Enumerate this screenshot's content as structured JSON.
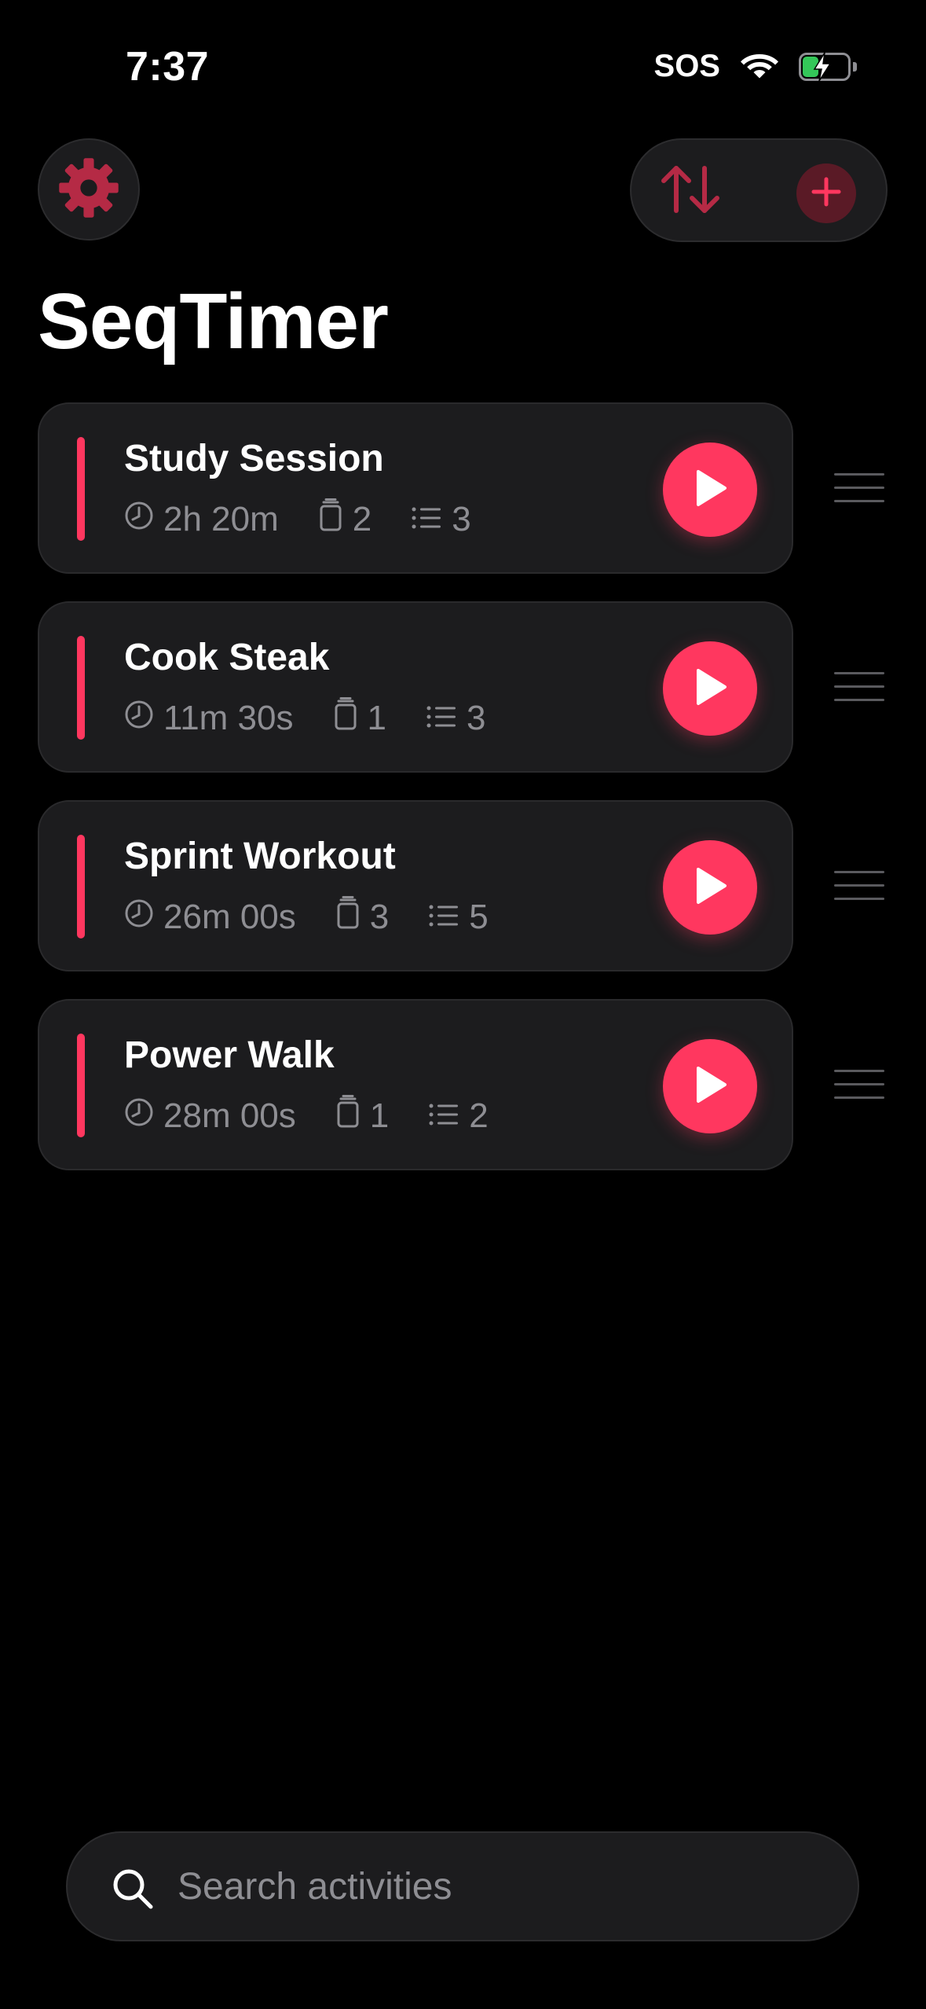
{
  "status_bar": {
    "time": "7:37",
    "carrier": "SOS",
    "battery_level": 0.35
  },
  "header": {
    "title": "SeqTimer"
  },
  "colors": {
    "accent": "#ff375f",
    "background": "#000000",
    "card": "#1c1c1e",
    "secondary_text": "#8e8e93",
    "battery_green": "#34c759"
  },
  "icons": {
    "settings": "gear-icon",
    "sort": "sort-arrows-icon",
    "add": "plus-icon",
    "duration": "clock-icon",
    "groups": "timer-group-icon",
    "steps": "list-icon",
    "play": "play-icon",
    "reorder": "drag-handle-icon",
    "search": "magnifier-icon"
  },
  "activities": [
    {
      "title": "Study Session",
      "duration": "2h 20m",
      "groups": "2",
      "steps": "3"
    },
    {
      "title": "Cook Steak",
      "duration": "11m 30s",
      "groups": "1",
      "steps": "3"
    },
    {
      "title": "Sprint Workout",
      "duration": "26m 00s",
      "groups": "3",
      "steps": "5"
    },
    {
      "title": "Power Walk",
      "duration": "28m 00s",
      "groups": "1",
      "steps": "2"
    }
  ],
  "search": {
    "placeholder": "Search activities",
    "value": ""
  }
}
